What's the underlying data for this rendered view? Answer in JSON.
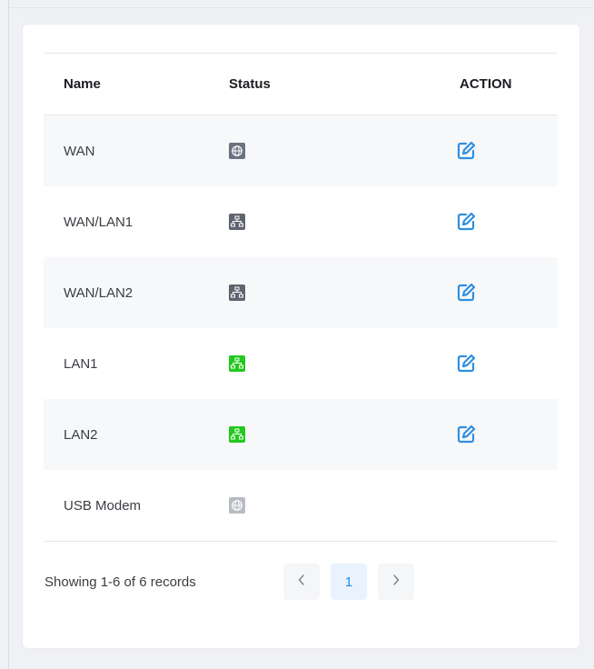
{
  "table": {
    "headers": {
      "name": "Name",
      "status": "Status",
      "action": "ACTION"
    },
    "rows": [
      {
        "name": "WAN",
        "status_icon": "globe-icon",
        "status_color": "#6b7280",
        "editable": true
      },
      {
        "name": "WAN/LAN1",
        "status_icon": "network-icon",
        "status_color": "#5f6470",
        "editable": true
      },
      {
        "name": "WAN/LAN2",
        "status_icon": "network-icon",
        "status_color": "#5f6470",
        "editable": true
      },
      {
        "name": "LAN1",
        "status_icon": "network-icon",
        "status_color": "#22c81e",
        "editable": true
      },
      {
        "name": "LAN2",
        "status_icon": "network-icon",
        "status_color": "#22c81e",
        "editable": true
      },
      {
        "name": "USB Modem",
        "status_icon": "globe-icon",
        "status_color": "#b8bcc4",
        "editable": false
      }
    ]
  },
  "pagination": {
    "summary": "Showing 1-6 of 6 records",
    "current_page": "1",
    "prev_icon": "chevron-left-icon",
    "next_icon": "chevron-right-icon"
  },
  "colors": {
    "accent": "#1f8ce6",
    "edit_icon": "#2f8fe0",
    "online": "#22c81e",
    "offline_dark": "#5f6470",
    "disabled": "#b8bcc4"
  }
}
